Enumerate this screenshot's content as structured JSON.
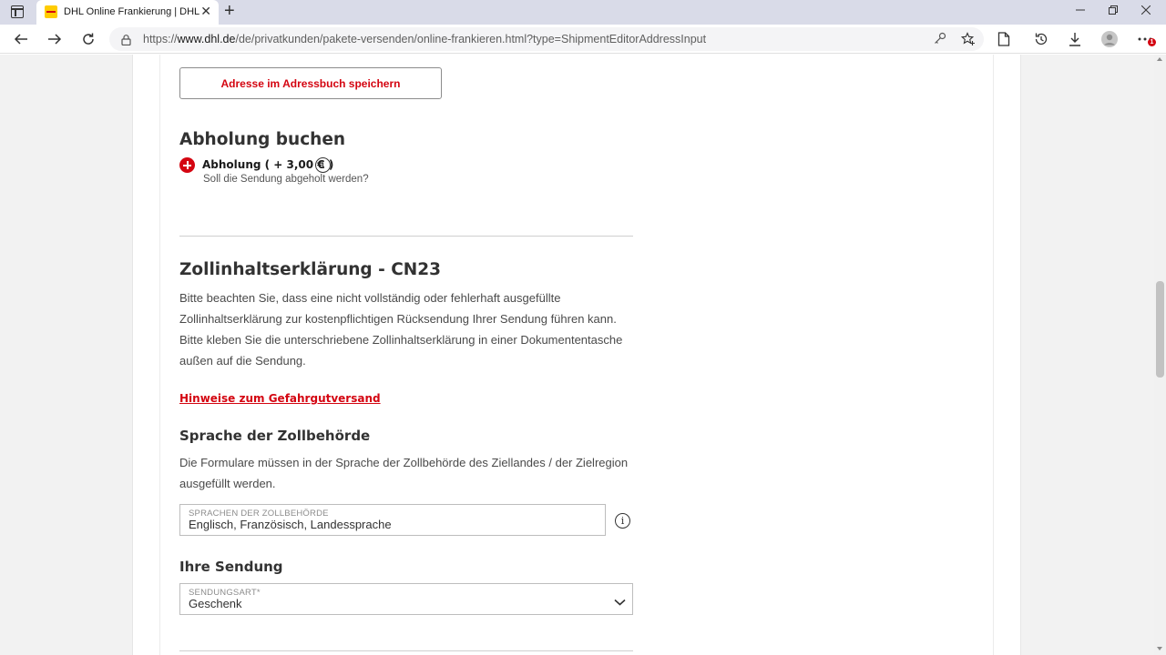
{
  "browser": {
    "tab_title": "DHL Online Frankierung | DHL",
    "tab_close": "✕",
    "new_tab": "+",
    "url_prefix": "https://",
    "url_host": "www.dhl.de",
    "url_path": "/de/privatkunden/pakete-versenden/online-frankieren.html?type=ShipmentEditorAddressInput",
    "notification_count": "1"
  },
  "address_book": {
    "save_label": "Adresse im Adressbuch speichern"
  },
  "pickup": {
    "heading": "Abholung buchen",
    "option_label": "Abholung ( + 3,00 € )",
    "info_glyph": "i",
    "question": "Soll die Sendung abgeholt werden?"
  },
  "customs": {
    "heading": "Zollinhaltserklärung - CN23",
    "notice_lines": [
      "Bitte beachten Sie, dass eine nicht vollständig oder fehlerhaft ausgefüllte",
      "Zollinhaltserklärung zur kostenpflichtigen Rücksendung Ihrer Sendung führen kann.",
      "Bitte kleben Sie die unterschriebene Zollinhaltserklärung in einer Dokumententasche",
      "außen auf die Sendung."
    ],
    "hazard_link": "Hinweise zum Gefahrgutversand"
  },
  "language": {
    "heading": "Sprache der Zollbehörde",
    "description_lines": [
      "Die Formulare müssen in der Sprache der Zollbehörde des Ziellandes / der Zielregion",
      "ausgefüllt werden."
    ],
    "field_label": "SPRACHEN DER ZOLLBEHÖRDE",
    "field_value": "Englisch, Französisch, Landessprache",
    "info_glyph": "i"
  },
  "shipment": {
    "heading": "Ihre Sendung",
    "select_label": "SENDUNGSART*",
    "select_value": "Geschenk"
  },
  "colors": {
    "accent_red": "#d40511",
    "dhl_yellow": "#ffcc00"
  }
}
